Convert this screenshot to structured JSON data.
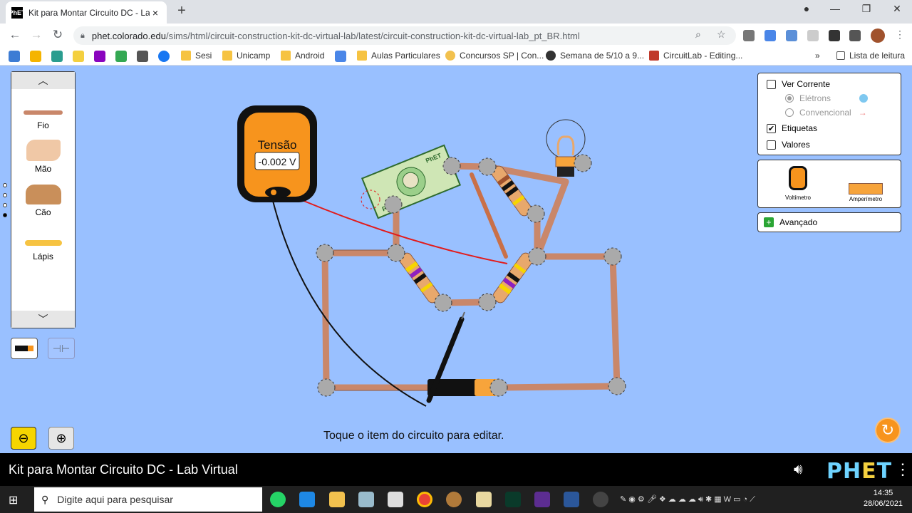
{
  "browser": {
    "tab_title": "Kit para Montar Circuito DC - Lab",
    "tab_favicon": "PhET",
    "new_tab": "+",
    "url_host": "phet.colorado.edu",
    "url_path": "/sims/html/circuit-construction-kit-dc-virtual-lab/latest/circuit-construction-kit-dc-virtual-lab_pt_BR.html",
    "back": "←",
    "forward": "→",
    "reload": "↻",
    "window_minimize": "—",
    "window_maximize": "❐",
    "window_close": "✕"
  },
  "bookmarks": {
    "items": [
      {
        "label": "Sesi"
      },
      {
        "label": "Unicamp"
      },
      {
        "label": "Android"
      },
      {
        "label": "Aulas Particulares"
      },
      {
        "label": "Concursos SP | Con..."
      },
      {
        "label": "Semana de 5/10 a 9..."
      },
      {
        "label": "CircuitLab - Editing..."
      }
    ],
    "overflow": "»",
    "reading_list": "Lista de leitura"
  },
  "toolbox": {
    "items": [
      {
        "label": "Fio"
      },
      {
        "label": "Mão"
      },
      {
        "label": "Cão"
      },
      {
        "label": "Lápis"
      }
    ],
    "up_arrow": "︿",
    "down_arrow": "﹀"
  },
  "voltmeter": {
    "title": "Tensão",
    "value": "-0.002 V"
  },
  "view_panel": {
    "ver_corrente": "Ver Corrente",
    "electrons": "Elétrons",
    "convencional": "Convencional",
    "etiquetas": "Etiquetas",
    "valores": "Valores",
    "etiquetas_checked": true,
    "ver_corrente_checked": false,
    "valores_checked": false
  },
  "tools_panel": {
    "voltimetro": "Voltímetro",
    "amperimetro": "Amperímetro"
  },
  "advanced": {
    "label": "Avançado",
    "icon": "+"
  },
  "hint": "Toque o item do circuito para editar.",
  "navbar": {
    "sim_title": "Kit para Montar Circuito DC - Lab Virtual",
    "logo_p": "PH",
    "logo_e": "E",
    "logo_t": "T"
  },
  "taskbar": {
    "search_placeholder": "Digite aqui para pesquisar",
    "time": "14:35",
    "date": "28/06/2021"
  },
  "bill": {
    "label": "PhET"
  },
  "colors": {
    "sim_background": "#99c0ff",
    "wire": "#c9876a",
    "accent_orange": "#f7941d",
    "red_probe": "#e21b1b"
  }
}
